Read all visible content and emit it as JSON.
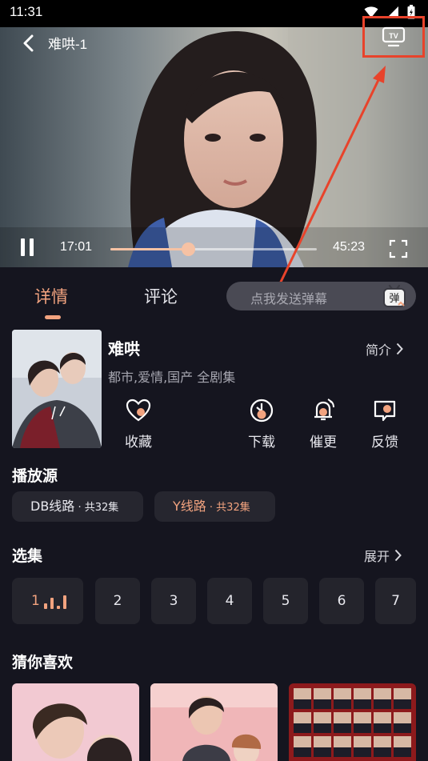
{
  "status_bar": {
    "time": "11:31"
  },
  "player": {
    "title": "难哄-1",
    "current_time": "17:01",
    "duration": "45:23",
    "progress": 0.375,
    "accent": "#f6c2a4",
    "highlight_color": "#e8432b",
    "tv_icon_text": "TV"
  },
  "tabs": {
    "details": "详情",
    "comments": "评论"
  },
  "danmaku": {
    "placeholder": "点我发送弹幕",
    "icon_text": "弹"
  },
  "show": {
    "title": "难哄",
    "tags": "都市,爱情,国产 全剧集",
    "intro_label": "简介",
    "actions": [
      {
        "label": "收藏",
        "icon": "heart-icon"
      },
      {
        "label": "下载",
        "icon": "download-icon"
      },
      {
        "label": "催更",
        "icon": "bell-icon"
      },
      {
        "label": "反馈",
        "icon": "feedback-icon"
      }
    ]
  },
  "sources": {
    "title": "播放源",
    "items": [
      {
        "name": "DB线路",
        "count": " · 共32集",
        "selected": false
      },
      {
        "name": "Y线路",
        "count": " · 共32集",
        "selected": true
      }
    ]
  },
  "episodes": {
    "title": "选集",
    "expand_label": "展开",
    "items": [
      "1",
      "2",
      "3",
      "4",
      "5",
      "6",
      "7"
    ],
    "current": "1"
  },
  "recommend": {
    "title": "猜你喜欢"
  }
}
